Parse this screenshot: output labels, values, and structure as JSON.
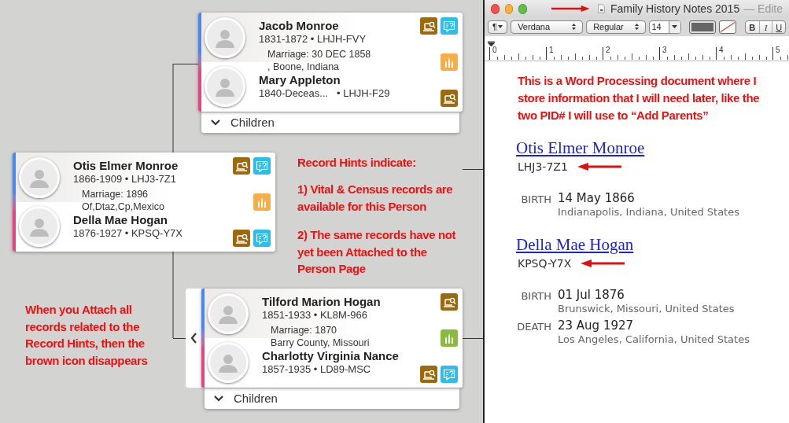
{
  "tree": {
    "couples": [
      {
        "husband": {
          "name": "Jacob Monroe",
          "dates": "1831-1872 • LHJH-FVY",
          "hints": [
            {
              "kind": "record-hint"
            },
            {
              "kind": "research-help"
            }
          ]
        },
        "marriage": [
          "Marriage: 30 DEC 1858",
          ", Boone, Indiana"
        ],
        "temple": {
          "color": "#f6ae4b"
        },
        "wife": {
          "name": "Mary Appleton",
          "dates": "1840-Deceas...   • LHJH-F29",
          "hints": [
            {
              "kind": "record-hint"
            }
          ]
        },
        "children_toggle": "Children",
        "back_arrow": false
      },
      {
        "husband": {
          "name": "Otis Elmer Monroe",
          "dates": "1866-1909 • LHJ3-7Z1",
          "hints": [
            {
              "kind": "record-hint"
            },
            {
              "kind": "research-help"
            }
          ]
        },
        "marriage": [
          "Marriage: 1896",
          "Of,Dtaz,Cp,Mexico"
        ],
        "temple": {
          "color": "#f6ae4b"
        },
        "wife": {
          "name": "Della Mae Hogan",
          "dates": "1876-1927 • KPSQ-Y7X",
          "hints": [
            {
              "kind": "record-hint"
            },
            {
              "kind": "research-help"
            }
          ]
        },
        "back_arrow": false
      },
      {
        "husband": {
          "name": "Tilford Marion Hogan",
          "dates": "1851-1933 • KL8M-966",
          "hints": [
            {
              "kind": "record-hint"
            }
          ]
        },
        "marriage": [
          "Marriage: 1870",
          "Barry County, Missouri"
        ],
        "temple": {
          "color": "#8bbb3e"
        },
        "wife": {
          "name": "Charlotty Virginia Nance",
          "dates": "1857-1935 • LD89-MSC",
          "hints": [
            {
              "kind": "record-hint"
            },
            {
              "kind": "research-help"
            }
          ]
        },
        "children_toggle": "Children",
        "back_arrow": true
      }
    ],
    "notes": [
      "Record Hints indicate:",
      "1) Vital & Census records are available for this Person",
      "2) The same records have not yet been Attached to the Person Page",
      "When you Attach all records related to the Record Hints, then the brown icon disappears"
    ]
  },
  "editor": {
    "window": {
      "title": "Family History Notes 2015",
      "title_suffix": "— Edite"
    },
    "toolbar": {
      "paragraph": "¶",
      "font_family": "Verdana",
      "font_style": "Regular",
      "font_size": "14",
      "bold": "B",
      "italic": "I",
      "underline": "U"
    },
    "ruler": [
      "0",
      "1",
      "2",
      "3",
      "4",
      "5"
    ],
    "note": "This is a Word Processing document where I store information that I will need later, like the two PID# I will use to “Add Parents”",
    "people": [
      {
        "name": "Otis Elmer Monroe",
        "pid": "LHJ3-7Z1",
        "events": [
          {
            "label": "BIRTH",
            "date": "14 May 1866",
            "place": "Indianapolis, Indiana, United States"
          }
        ]
      },
      {
        "name": "Della Mae Hogan",
        "pid": "KPSQ-Y7X",
        "events": [
          {
            "label": "BIRTH",
            "date": "01 Jul 1876",
            "place": "Brunswick, Missouri, United States"
          },
          {
            "label": "DEATH",
            "date": "23 Aug 1927",
            "place": "Los Angeles, California, United States"
          }
        ]
      }
    ]
  }
}
